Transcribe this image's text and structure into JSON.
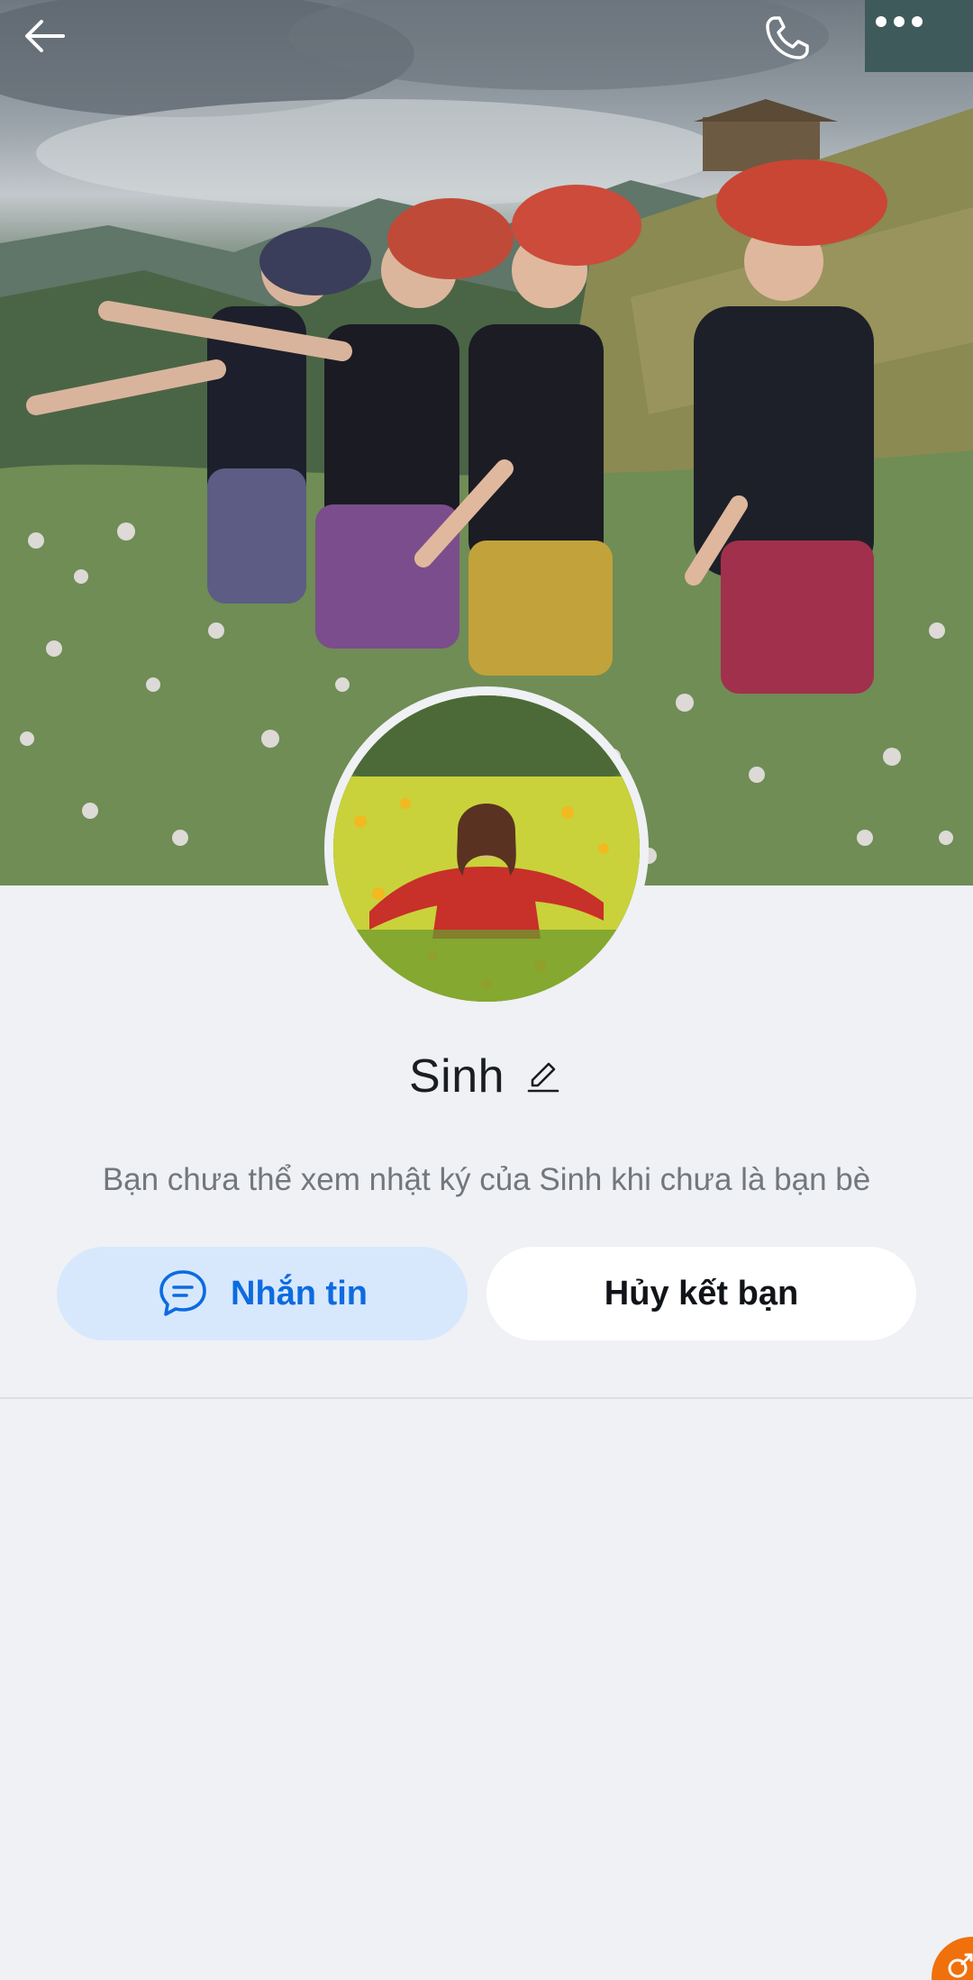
{
  "profile": {
    "name": "Sinh",
    "notice": "Bạn chưa thể xem nhật ký của Sinh khi chưa là bạn bè"
  },
  "actions": {
    "message_label": "Nhắn tin",
    "unfriend_label": "Hủy kết bạn"
  },
  "icons": {
    "back": "arrow-left-icon",
    "call": "phone-icon",
    "more": "more-horizontal-icon",
    "edit": "pencil-icon",
    "message": "chat-bubble-icon",
    "floating": "link-icon"
  },
  "colors": {
    "background": "#eff1f4",
    "accent": "#0d6be0",
    "accent_soft": "#d7e8fd",
    "floating": "#f0700c"
  }
}
